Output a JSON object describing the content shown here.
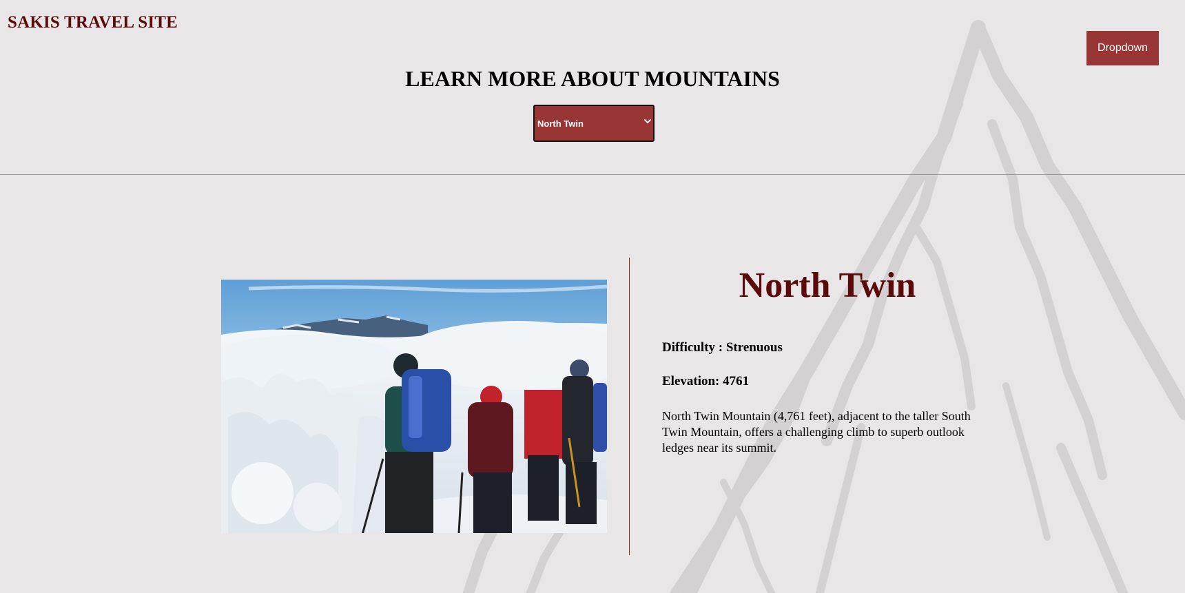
{
  "header": {
    "site_title": "SAKIS TRAVEL SITE",
    "dropdown_label": "Dropdown"
  },
  "main": {
    "heading": "LEARN MORE ABOUT MOUNTAINS",
    "mountain_select": {
      "selected": "North Twin"
    },
    "mountain": {
      "name": "North Twin",
      "difficulty": "Difficulty : Strenuous",
      "elevation": "Elevation: 4761",
      "description": "North Twin Mountain (4,761 feet), adjacent to the taller South Twin Mountain, offers a challenging climb to superb outlook ledges near its summit."
    }
  },
  "colors": {
    "background": "#e8e6e7",
    "accent": "#983636",
    "title": "#5a0a0a"
  },
  "icons": {
    "select_arrow": "chevron-down-icon"
  }
}
